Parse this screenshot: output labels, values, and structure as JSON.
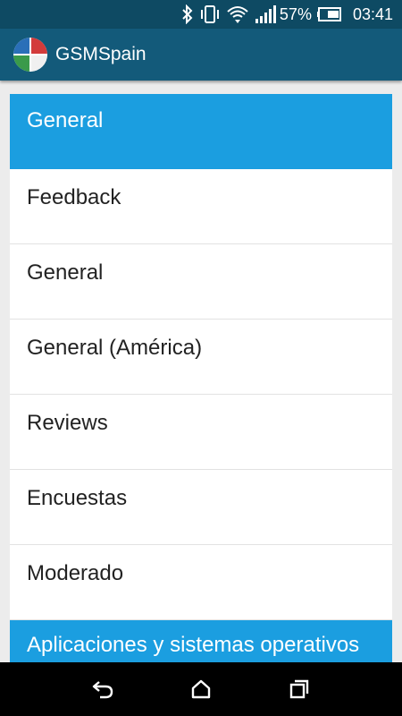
{
  "status_bar": {
    "battery_percent": "57%",
    "time": "03:41",
    "icons": [
      "bluetooth-icon",
      "vibrate-icon",
      "wifi-icon",
      "signal-icon",
      "battery-icon"
    ]
  },
  "app_bar": {
    "title": "GSMSpain",
    "logo": "gsmspain-logo",
    "color": "#135a7a"
  },
  "sections": [
    {
      "header": "General",
      "items": [
        "Feedback",
        "General",
        "General (América)",
        "Reviews",
        "Encuestas",
        "Moderado"
      ]
    },
    {
      "header": "Aplicaciones y sistemas operativos",
      "items": []
    }
  ],
  "colors": {
    "section_header": "#1b9ee0",
    "status_bar": "#0e4a63"
  },
  "nav_bar": {
    "buttons": [
      "back-icon",
      "home-icon",
      "recents-icon"
    ]
  }
}
